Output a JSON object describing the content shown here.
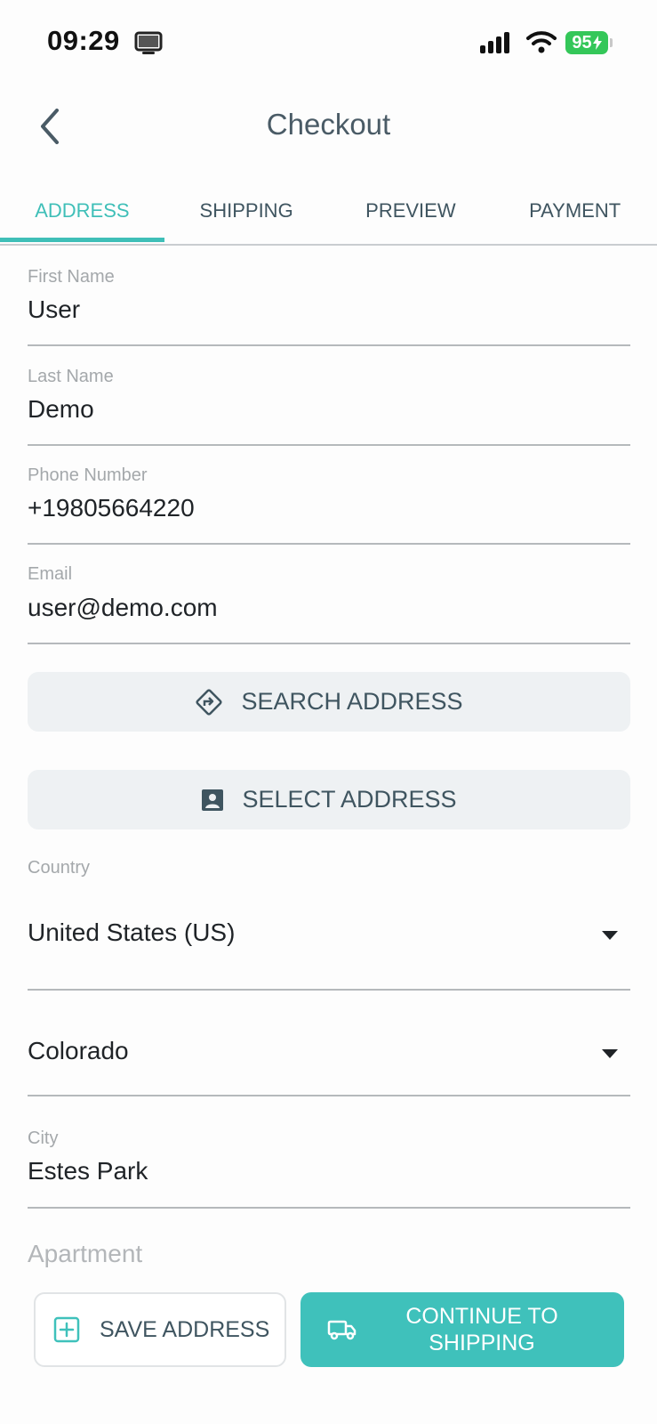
{
  "status_bar": {
    "time": "09:29",
    "battery": "95"
  },
  "header": {
    "title": "Checkout",
    "back_icon": "chevron-left-icon"
  },
  "tabs": [
    {
      "label": "ADDRESS",
      "active": true
    },
    {
      "label": "SHIPPING",
      "active": false
    },
    {
      "label": "PREVIEW",
      "active": false
    },
    {
      "label": "PAYMENT",
      "active": false
    }
  ],
  "form": {
    "first_name": {
      "label": "First Name",
      "value": "User"
    },
    "last_name": {
      "label": "Last Name",
      "value": "Demo"
    },
    "phone": {
      "label": "Phone Number",
      "value": "+19805664220"
    },
    "email": {
      "label": "Email",
      "value": "user@demo.com"
    },
    "search_address": {
      "label": "SEARCH ADDRESS",
      "icon": "directions-icon"
    },
    "select_address": {
      "label": "SELECT ADDRESS",
      "icon": "contact-card-icon"
    },
    "country": {
      "label": "Country",
      "value": "United States (US)"
    },
    "state": {
      "value": "Colorado"
    },
    "city": {
      "label": "City",
      "value": "Estes Park"
    },
    "apartment": {
      "placeholder": "Apartment"
    }
  },
  "actions": {
    "save_label": "SAVE ADDRESS",
    "continue_line1": "CONTINUE TO",
    "continue_line2": "SHIPPING"
  },
  "colors": {
    "accent": "#3fc1bb",
    "text": "#3f5560",
    "battery": "#34c759"
  }
}
